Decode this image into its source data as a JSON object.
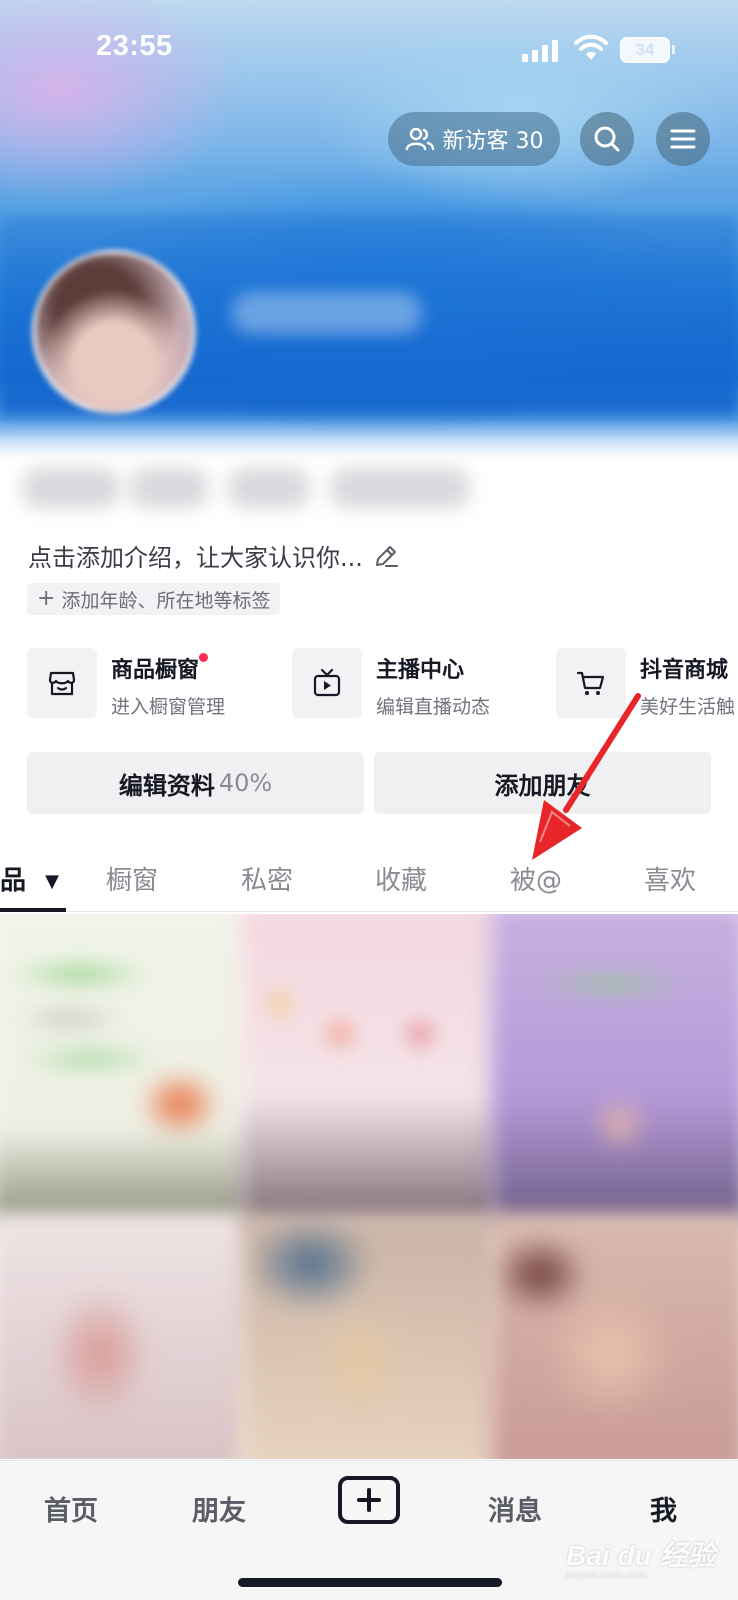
{
  "status_bar": {
    "time": "23:55",
    "battery": "34"
  },
  "header": {
    "visitor_label": "新访客 30",
    "search_icon": "search-icon",
    "menu_icon": "menu-icon"
  },
  "profile": {
    "intro": "点击添加介绍，让大家认识你...",
    "tag_chip": "添加年龄、所在地等标签"
  },
  "shortcuts": [
    {
      "title": "商品橱窗",
      "subtitle": "进入橱窗管理",
      "icon": "shop-icon",
      "has_dot": true
    },
    {
      "title": "主播中心",
      "subtitle": "编辑直播动态",
      "icon": "tv-icon",
      "has_dot": false
    },
    {
      "title": "抖音商城",
      "subtitle": "美好生活触",
      "icon": "cart-icon",
      "has_dot": false
    }
  ],
  "actions": {
    "edit_profile": "编辑资料",
    "edit_progress": "40%",
    "add_friend": "添加朋友"
  },
  "tabs": [
    {
      "label": "品",
      "active": true
    },
    {
      "label": "橱窗",
      "active": false
    },
    {
      "label": "私密",
      "active": false
    },
    {
      "label": "收藏",
      "active": false
    },
    {
      "label": "被@",
      "active": false
    },
    {
      "label": "喜欢",
      "active": false
    }
  ],
  "bottom_nav": {
    "home": "首页",
    "friends": "朋友",
    "messages": "消息",
    "me": "我"
  },
  "watermark": {
    "brand": "Bai du 经验",
    "url": "jingyan.baidu.com"
  },
  "colors": {
    "accent_red": "#fe2c55",
    "annotation_red": "#e8262a",
    "text_primary": "#161823"
  }
}
